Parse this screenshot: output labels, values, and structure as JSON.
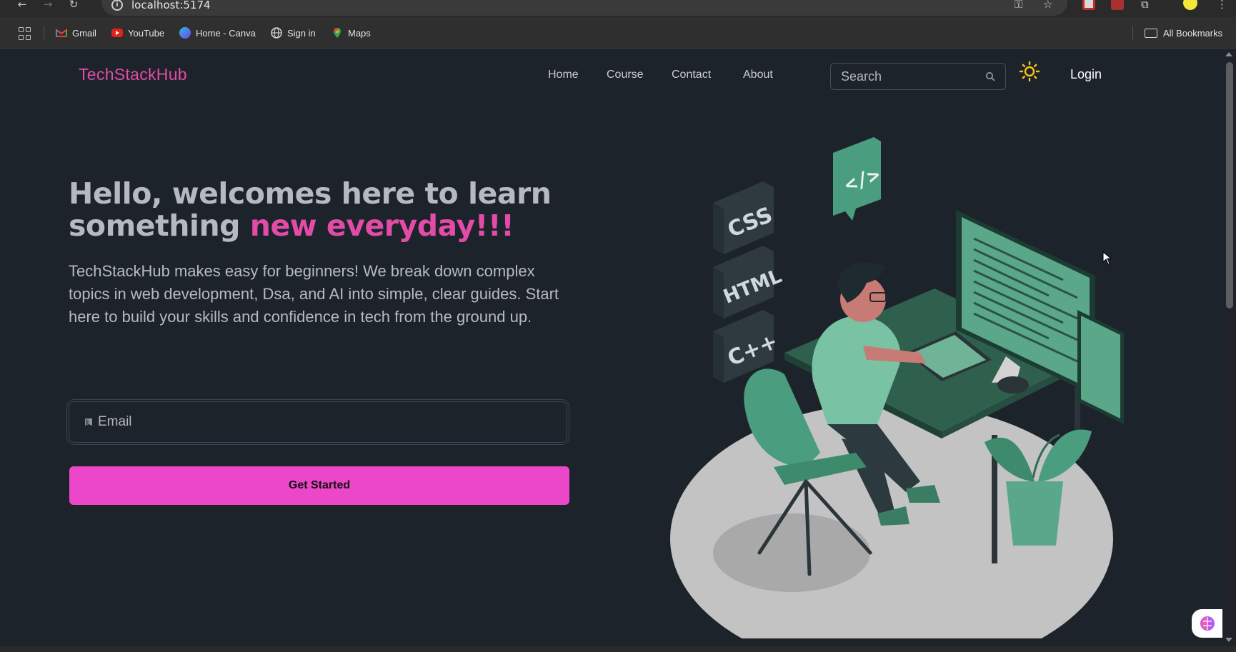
{
  "browser": {
    "url": "localhost:5174",
    "bookmarks": [
      {
        "label": "Gmail",
        "icon": "gmail-icon"
      },
      {
        "label": "YouTube",
        "icon": "youtube-icon"
      },
      {
        "label": "Home - Canva",
        "icon": "canva-icon"
      },
      {
        "label": "Sign in",
        "icon": "globe-icon"
      },
      {
        "label": "Maps",
        "icon": "maps-icon"
      }
    ],
    "all_bookmarks_label": "All Bookmarks"
  },
  "navbar": {
    "brand": "TechStackHub",
    "links": [
      "Home",
      "Course",
      "Contact",
      "About"
    ],
    "search_placeholder": "Search",
    "login_label": "Login"
  },
  "hero": {
    "title_part1": "Hello, welcomes here to learn",
    "title_part2": "something ",
    "title_accent": "new everyday!!!",
    "description": "TechStackHub makes easy for beginners! We break down complex topics in web development, Dsa, and AI into simple, clear guides. Start here to build your skills and confidence in tech from the ground up.",
    "email_placeholder": "Email",
    "cta_label": "Get Started"
  },
  "illustration": {
    "labels": [
      "CSS",
      "HTML",
      "C++"
    ]
  },
  "colors": {
    "accent": "#e34ba8",
    "button": "#ec46c9",
    "background": "#1d232a",
    "illustration_green": "#4a9d7f"
  }
}
